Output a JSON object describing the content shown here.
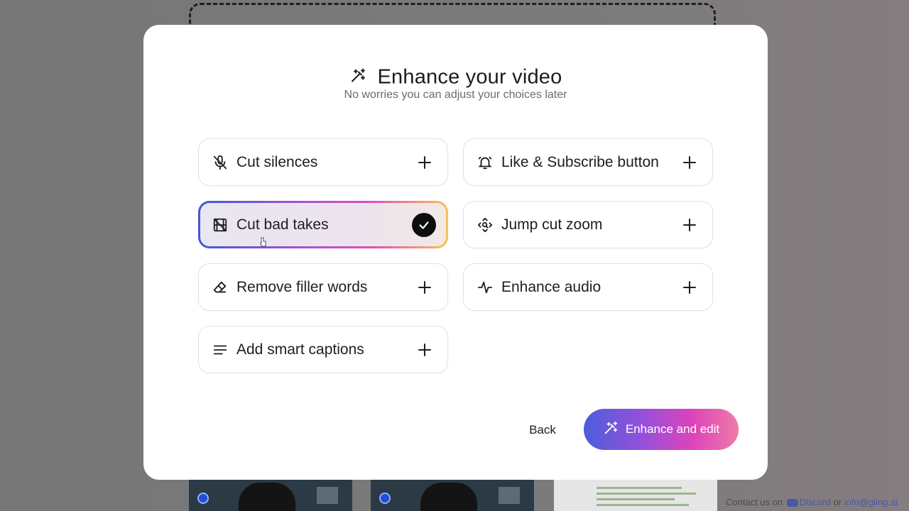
{
  "modal": {
    "title": "Enhance your video",
    "subtitle": "No worries you can adjust your choices later",
    "options": [
      {
        "label": "Cut silences",
        "icon": "mic-off-icon",
        "selected": false
      },
      {
        "label": "Like & Subscribe button",
        "icon": "bell-icon",
        "selected": false
      },
      {
        "label": "Cut bad takes",
        "icon": "film-cut-icon",
        "selected": true
      },
      {
        "label": "Jump cut zoom",
        "icon": "zoom-focus-icon",
        "selected": false
      },
      {
        "label": "Remove filler words",
        "icon": "eraser-icon",
        "selected": false
      },
      {
        "label": "Enhance audio",
        "icon": "waveform-icon",
        "selected": false
      },
      {
        "label": "Add smart captions",
        "icon": "text-lines-icon",
        "selected": false
      }
    ],
    "back_label": "Back",
    "primary_label": "Enhance and edit"
  },
  "footer": {
    "contact_prefix": "Contact us on",
    "discord_label": "Discord",
    "or_label": "or",
    "email_label": "info@gling.ai"
  },
  "colors": {
    "accent_start": "#4b5fdc",
    "accent_mid": "#a352d8",
    "accent_pink": "#e24fb8",
    "accent_end": "#f6c35a"
  }
}
